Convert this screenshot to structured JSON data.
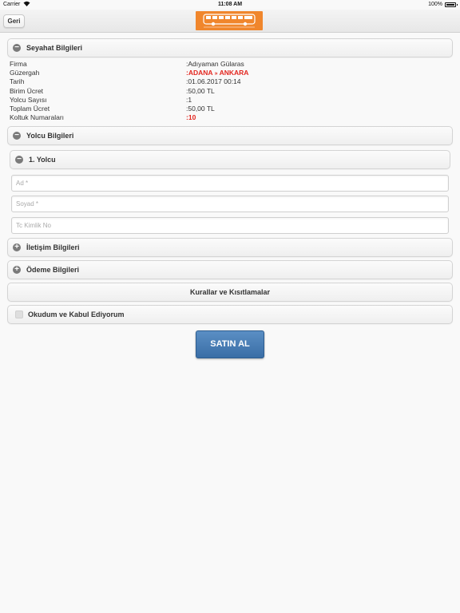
{
  "status_bar": {
    "carrier": "Carrier",
    "time": "11:08 AM",
    "battery": "100%"
  },
  "header": {
    "back_label": "Geri",
    "logo_color": "#f0862c"
  },
  "travel_section": {
    "title": "Seyahat Bilgileri",
    "rows": [
      {
        "label": "Firma",
        "value": ":Adıyaman Gülaras"
      },
      {
        "label": "Güzergah",
        "value_prefix": ":",
        "origin": "ADANA",
        "arrow": "»",
        "destination": "ANKARA"
      },
      {
        "label": "Tarih",
        "value": ":01.06.2017 00:14"
      },
      {
        "label": "Birim Ücret",
        "value": ":50,00 TL"
      },
      {
        "label": "Yolcu Sayısı",
        "value": ":1"
      },
      {
        "label": "Toplam Ücret",
        "value": ":50,00 TL"
      },
      {
        "label": "Koltuk Numaraları",
        "value_prefix": ":",
        "value": "10"
      }
    ]
  },
  "passenger_section": {
    "title": "Yolcu Bilgileri",
    "passenger": {
      "title": "1. Yolcu",
      "first_name_placeholder": "Ad *",
      "last_name_placeholder": "Soyad *",
      "tc_placeholder": "Tc Kimlik No"
    }
  },
  "contact_section": {
    "title": "İletişim Bilgileri"
  },
  "payment_section": {
    "title": "Ödeme Bilgileri"
  },
  "rules_button": {
    "label": "Kurallar ve Kısıtlamalar"
  },
  "agree_checkbox": {
    "label": "Okudum ve Kabul Ediyorum",
    "checked": false
  },
  "buy_button": {
    "label": "SATIN AL",
    "color": "#4a7fb6"
  },
  "colors": {
    "accent_red": "#e3261f"
  }
}
